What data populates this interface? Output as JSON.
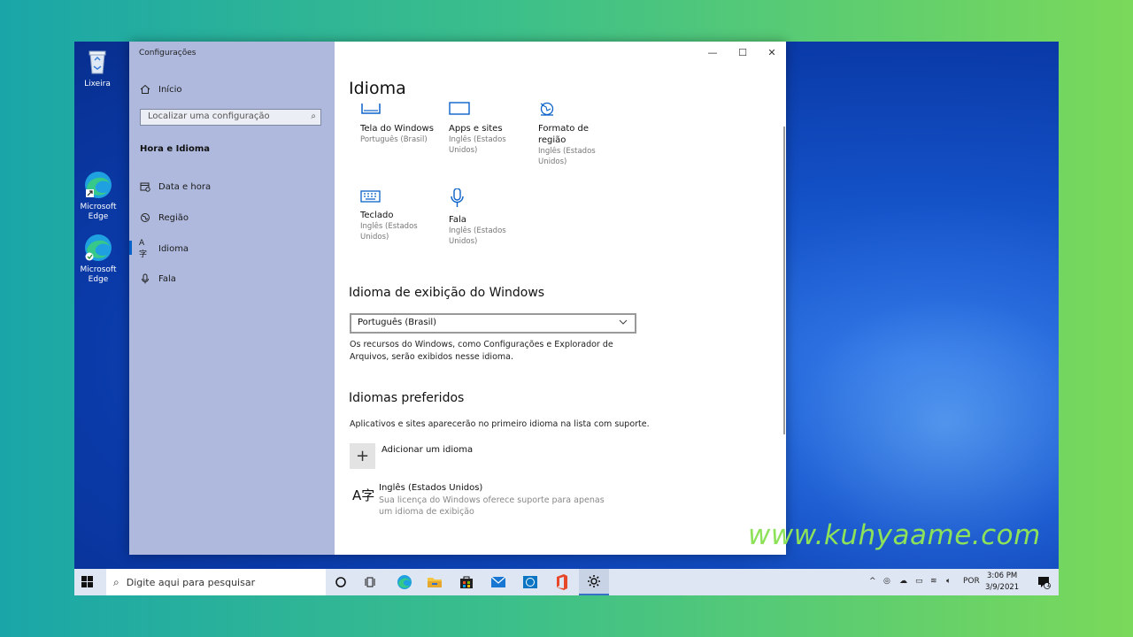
{
  "desktop": {
    "icons": [
      {
        "label": "Lixeira"
      },
      {
        "label": "Microsoft Edge"
      },
      {
        "label": "Microsoft Edge"
      }
    ],
    "watermark": "www.kuhyaame.com"
  },
  "window": {
    "app_title": "Configurações",
    "controls": {
      "minimize": "—",
      "maximize": "☐",
      "close": "✕"
    }
  },
  "sidebar": {
    "home_label": "Início",
    "search_placeholder": "Localizar uma configuração",
    "group_title": "Hora e Idioma",
    "items": [
      {
        "label": "Data e hora",
        "icon": "calendar-clock-icon"
      },
      {
        "label": "Região",
        "icon": "globe-region-icon"
      },
      {
        "label": "Idioma",
        "icon": "language-icon",
        "selected": true
      },
      {
        "label": "Fala",
        "icon": "microphone-icon"
      }
    ]
  },
  "main": {
    "title": "Idioma",
    "tiles": [
      {
        "name": "Tela do Windows",
        "sub": "Português (Brasil)",
        "icon": "display-icon"
      },
      {
        "name": "Apps e sites",
        "sub": "Inglês (Estados Unidos)",
        "icon": "browser-window-icon"
      },
      {
        "name": "Formato de região",
        "sub": "Inglês (Estados Unidos)",
        "icon": "region-format-icon"
      },
      {
        "name": "Teclado",
        "sub": "Inglês (Estados Unidos)",
        "icon": "keyboard-icon"
      },
      {
        "name": "Fala",
        "sub": "Inglês (Estados Unidos)",
        "icon": "microphone-icon"
      }
    ],
    "display_section": {
      "heading": "Idioma de exibição do Windows",
      "selected": "Português (Brasil)",
      "description": "Os recursos do Windows, como Configurações e Explorador de Arquivos, serão exibidos nesse idioma."
    },
    "preferred_section": {
      "heading": "Idiomas preferidos",
      "description": "Aplicativos e sites aparecerão no primeiro idioma na lista com suporte.",
      "add_label": "Adicionar um idioma",
      "language_name": "Inglês (Estados Unidos)",
      "language_desc": "Sua licença do Windows oferece suporte para apenas um idioma de exibição"
    }
  },
  "taskbar": {
    "search_placeholder": "Digite aqui para pesquisar",
    "apps": [
      "cortana-icon",
      "task-view-icon",
      "edge-icon",
      "file-explorer-icon",
      "store-icon",
      "mail-icon",
      "dell-icon",
      "office-icon",
      "settings-icon"
    ],
    "tray_lang": "POR",
    "time": "3:06 PM",
    "date": "3/9/2021",
    "notification_count": "1"
  },
  "colors": {
    "accent": "#0a62c8",
    "sidebar_bg": "#aeb9dd",
    "watermark": "#8de25a"
  }
}
